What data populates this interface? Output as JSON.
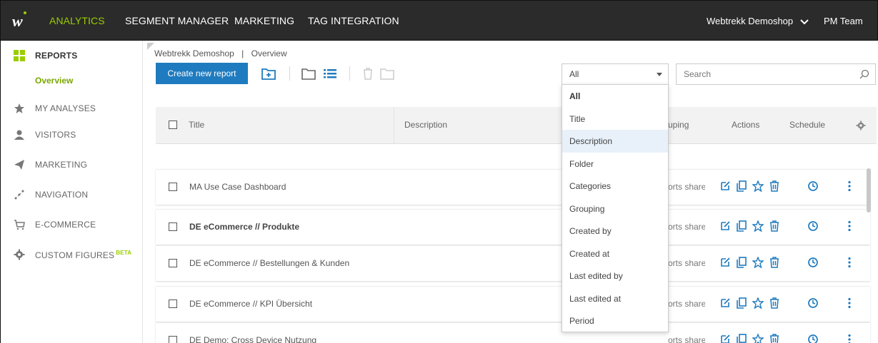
{
  "topnav": {
    "items": [
      "ANALYTICS",
      "SEGMENT MANAGER",
      "MARKETING",
      "TAG INTEGRATION"
    ],
    "account": "Webtrekk Demoshop",
    "team": "PM Team",
    "accent_color": "#9acd00"
  },
  "sidebar": {
    "reports_label": "REPORTS",
    "overview_label": "Overview",
    "items": [
      "MY ANALYSES",
      "VISITORS",
      "MARKETING",
      "NAVIGATION",
      "E-COMMERCE",
      "CUSTOM FIGURES"
    ],
    "beta_badge": "BETA"
  },
  "breadcrumb": {
    "account": "Webtrekk Demoshop",
    "separator": "|",
    "page": "Overview"
  },
  "toolbar": {
    "create_label": "Create new report"
  },
  "filter": {
    "selected": "All",
    "search_placeholder": "Search"
  },
  "table": {
    "headers": {
      "title": "Title",
      "description": "Description",
      "grouping": "uping",
      "actions": "Actions",
      "schedule": "Schedule"
    },
    "rows": [
      {
        "title": "MA Use Case Dashboard",
        "grouping": "orts share"
      },
      {
        "title": "DE eCommerce // Produkte",
        "grouping": "orts share"
      },
      {
        "title": "DE eCommerce // Bestellungen & Kunden",
        "grouping": "orts share"
      },
      {
        "title": "DE eCommerce // KPI Übersicht",
        "grouping": "orts share"
      },
      {
        "title": "DE Demo: Cross Device Nutzung",
        "grouping": "orts share"
      }
    ]
  },
  "dropdown": {
    "options": [
      "All",
      "Title",
      "Description",
      "Folder",
      "Categories",
      "Grouping",
      "Created by",
      "Created at",
      "Last edited by",
      "Last edited at",
      "Period"
    ],
    "selected": "All",
    "hovered": "Description"
  },
  "colors": {
    "primary_button": "#1f7bbf",
    "icon_blue": "#1f7bbf",
    "topbar": "#2b2b2b"
  }
}
